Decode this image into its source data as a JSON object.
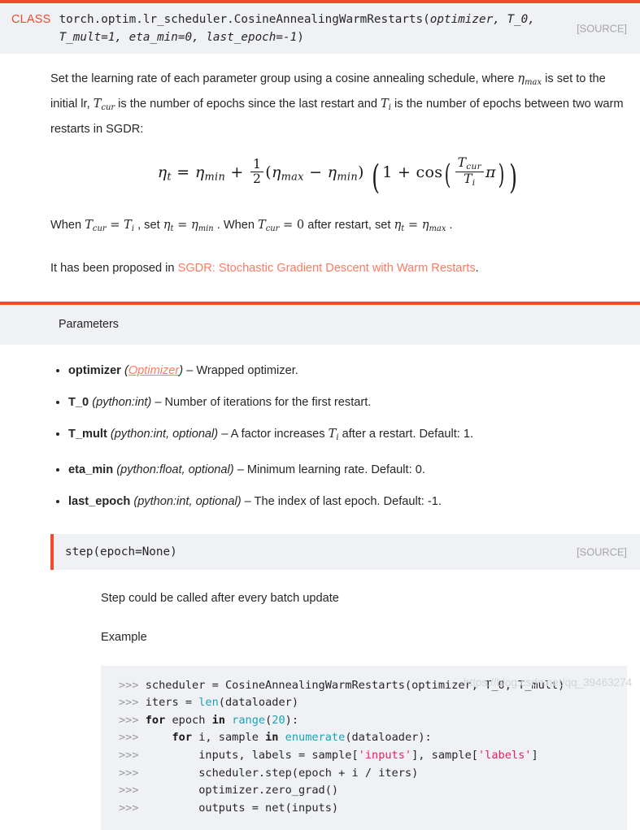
{
  "class_signature": {
    "keyword": "CLASS",
    "path": "torch.optim.lr_scheduler.CosineAnnealingWarmRestarts",
    "open_paren": "(",
    "args_line1": "optimizer, T_0,",
    "args_line2": "T_mult=1, eta_min=0, last_epoch=-1",
    "close_paren": ")",
    "source_label": "[SOURCE]"
  },
  "description": {
    "part1": "Set the learning rate of each parameter group using a cosine annealing schedule, where ",
    "eta_max": "η",
    "eta_max_sub": "max",
    "part2": " is set to the initial lr, ",
    "t_cur": "T",
    "t_cur_sub": "cur",
    "part3": " is the number of epochs since the last restart and ",
    "t_i": "T",
    "t_i_sub": "i",
    "part4": " is the number of epochs between two warm restarts in SGDR:"
  },
  "equation": {
    "lhs_sym": "η",
    "lhs_sub": "t",
    "eq": "=",
    "eta_min": "η",
    "eta_min_sub": "min",
    "plus": "+",
    "frac_num": "1",
    "frac_den": "2",
    "eta_max": "η",
    "eta_max_sub": "max",
    "minus": "−",
    "one": "1",
    "cos": "cos",
    "t_cur": "T",
    "t_cur_sub": "cur",
    "t_i": "T",
    "t_i_sub": "i",
    "pi": "π"
  },
  "when_line": {
    "when1": "When ",
    "t_cur": "T",
    "t_cur_sub": "cur",
    "eq1": " = ",
    "t_i": "T",
    "t_i_sub": "i",
    "set1": " , set ",
    "eta_t": "η",
    "eta_t_sub": "t",
    "eq2": " = ",
    "eta_min": "η",
    "eta_min_sub": "min",
    "when2": " . When ",
    "eq3": " = ",
    "zero": "0",
    "after": " after restart, set ",
    "eta_max": "η",
    "eta_max_sub": "max",
    "period": " ."
  },
  "proposed": {
    "prefix": "It has been proposed in ",
    "link_text": "SGDR: Stochastic Gradient Descent with Warm Restarts",
    "suffix": "."
  },
  "parameters": {
    "title": "Parameters",
    "items": [
      {
        "name": "optimizer",
        "type_prefix": "(",
        "type_link": "Optimizer",
        "type_suffix": ")",
        "desc": " – Wrapped optimizer."
      },
      {
        "name": "T_0",
        "type_prefix": "(",
        "type_plain": "python:int",
        "type_suffix": ")",
        "desc": " – Number of iterations for the first restart."
      },
      {
        "name": "T_mult",
        "type_prefix": "(",
        "type_plain": "python:int, optional",
        "type_suffix": ")",
        "desc_before": " – A factor increases ",
        "math_sym": "T",
        "math_sub": "i",
        "desc_after": " after a restart. Default: 1."
      },
      {
        "name": "eta_min",
        "type_prefix": "(",
        "type_plain": "python:float, optional",
        "type_suffix": ")",
        "desc": " – Minimum learning rate. Default: 0."
      },
      {
        "name": "last_epoch",
        "type_prefix": "(",
        "type_plain": "python:int, optional",
        "type_suffix": ")",
        "desc": " – The index of last epoch. Default: -1."
      }
    ]
  },
  "method": {
    "name": "step",
    "open_paren": "(",
    "args": "epoch=None",
    "close_paren": ")",
    "source_label": "[SOURCE]",
    "body_text": "Step could be called after every batch update",
    "example_heading": "Example"
  },
  "code_block": {
    "lines": [
      ">>> scheduler = CosineAnnealingWarmRestarts(optimizer, T_0, T_mult)",
      ">>> iters = len(dataloader)",
      ">>> for epoch in range(20):",
      ">>>     for i, sample in enumerate(dataloader):",
      ">>>         inputs, labels = sample['inputs'], sample['labels']",
      ">>>         scheduler.step(epoch + i / iters)",
      ">>>         optimizer.zero_grad()",
      ">>>         outputs = net(inputs)"
    ]
  },
  "watermark": "https://blog.csdn.net/qq_39463274",
  "colors": {
    "accent": "#ee4c2c",
    "panel_bg": "#f0f1f5",
    "link": "#ff7a63",
    "code_builtin": "#1ba3b5",
    "code_string": "#e0245e",
    "source_gray": "#a6a6a6",
    "text": "#262626"
  }
}
